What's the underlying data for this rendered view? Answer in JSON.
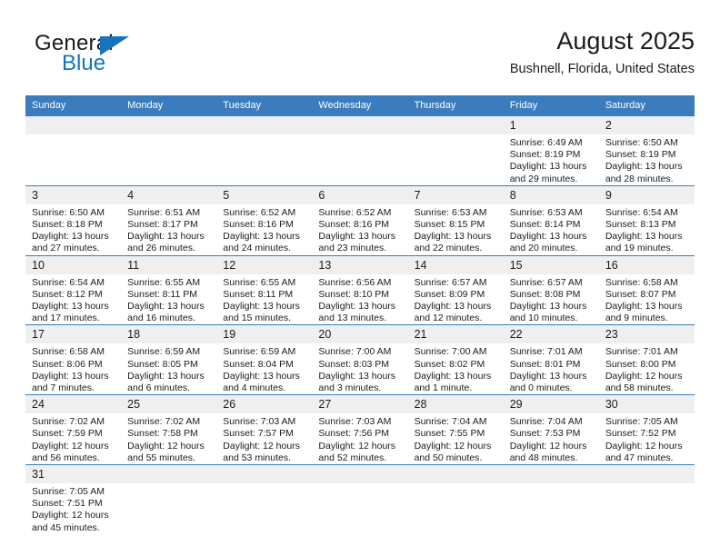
{
  "brand": {
    "word_general": "General",
    "word_blue": "Blue",
    "triangle_color": "#1574bb"
  },
  "header": {
    "title": "August 2025",
    "subtitle": "Bushnell, Florida, United States"
  },
  "colors": {
    "header_row": "#3b7cbe",
    "daynum_band": "#efefef",
    "accent": "#1574bb",
    "text": "#1b1b1b"
  },
  "labels": {
    "sunrise_prefix": "Sunrise:",
    "sunset_prefix": "Sunset:",
    "daylight_prefix": "Daylight:"
  },
  "weekdays": [
    "Sunday",
    "Monday",
    "Tuesday",
    "Wednesday",
    "Thursday",
    "Friday",
    "Saturday"
  ],
  "weeks": [
    [
      {
        "day": "",
        "empty": true
      },
      {
        "day": "",
        "empty": true
      },
      {
        "day": "",
        "empty": true
      },
      {
        "day": "",
        "empty": true
      },
      {
        "day": "",
        "empty": true
      },
      {
        "day": "1",
        "sunrise": "Sunrise: 6:49 AM",
        "sunset": "Sunset: 8:19 PM",
        "daylight_line1": "Daylight: 13 hours",
        "daylight_line2": "and 29 minutes."
      },
      {
        "day": "2",
        "sunrise": "Sunrise: 6:50 AM",
        "sunset": "Sunset: 8:19 PM",
        "daylight_line1": "Daylight: 13 hours",
        "daylight_line2": "and 28 minutes."
      }
    ],
    [
      {
        "day": "3",
        "sunrise": "Sunrise: 6:50 AM",
        "sunset": "Sunset: 8:18 PM",
        "daylight_line1": "Daylight: 13 hours",
        "daylight_line2": "and 27 minutes."
      },
      {
        "day": "4",
        "sunrise": "Sunrise: 6:51 AM",
        "sunset": "Sunset: 8:17 PM",
        "daylight_line1": "Daylight: 13 hours",
        "daylight_line2": "and 26 minutes."
      },
      {
        "day": "5",
        "sunrise": "Sunrise: 6:52 AM",
        "sunset": "Sunset: 8:16 PM",
        "daylight_line1": "Daylight: 13 hours",
        "daylight_line2": "and 24 minutes."
      },
      {
        "day": "6",
        "sunrise": "Sunrise: 6:52 AM",
        "sunset": "Sunset: 8:16 PM",
        "daylight_line1": "Daylight: 13 hours",
        "daylight_line2": "and 23 minutes."
      },
      {
        "day": "7",
        "sunrise": "Sunrise: 6:53 AM",
        "sunset": "Sunset: 8:15 PM",
        "daylight_line1": "Daylight: 13 hours",
        "daylight_line2": "and 22 minutes."
      },
      {
        "day": "8",
        "sunrise": "Sunrise: 6:53 AM",
        "sunset": "Sunset: 8:14 PM",
        "daylight_line1": "Daylight: 13 hours",
        "daylight_line2": "and 20 minutes."
      },
      {
        "day": "9",
        "sunrise": "Sunrise: 6:54 AM",
        "sunset": "Sunset: 8:13 PM",
        "daylight_line1": "Daylight: 13 hours",
        "daylight_line2": "and 19 minutes."
      }
    ],
    [
      {
        "day": "10",
        "sunrise": "Sunrise: 6:54 AM",
        "sunset": "Sunset: 8:12 PM",
        "daylight_line1": "Daylight: 13 hours",
        "daylight_line2": "and 17 minutes."
      },
      {
        "day": "11",
        "sunrise": "Sunrise: 6:55 AM",
        "sunset": "Sunset: 8:11 PM",
        "daylight_line1": "Daylight: 13 hours",
        "daylight_line2": "and 16 minutes."
      },
      {
        "day": "12",
        "sunrise": "Sunrise: 6:55 AM",
        "sunset": "Sunset: 8:11 PM",
        "daylight_line1": "Daylight: 13 hours",
        "daylight_line2": "and 15 minutes."
      },
      {
        "day": "13",
        "sunrise": "Sunrise: 6:56 AM",
        "sunset": "Sunset: 8:10 PM",
        "daylight_line1": "Daylight: 13 hours",
        "daylight_line2": "and 13 minutes."
      },
      {
        "day": "14",
        "sunrise": "Sunrise: 6:57 AM",
        "sunset": "Sunset: 8:09 PM",
        "daylight_line1": "Daylight: 13 hours",
        "daylight_line2": "and 12 minutes."
      },
      {
        "day": "15",
        "sunrise": "Sunrise: 6:57 AM",
        "sunset": "Sunset: 8:08 PM",
        "daylight_line1": "Daylight: 13 hours",
        "daylight_line2": "and 10 minutes."
      },
      {
        "day": "16",
        "sunrise": "Sunrise: 6:58 AM",
        "sunset": "Sunset: 8:07 PM",
        "daylight_line1": "Daylight: 13 hours",
        "daylight_line2": "and 9 minutes."
      }
    ],
    [
      {
        "day": "17",
        "sunrise": "Sunrise: 6:58 AM",
        "sunset": "Sunset: 8:06 PM",
        "daylight_line1": "Daylight: 13 hours",
        "daylight_line2": "and 7 minutes."
      },
      {
        "day": "18",
        "sunrise": "Sunrise: 6:59 AM",
        "sunset": "Sunset: 8:05 PM",
        "daylight_line1": "Daylight: 13 hours",
        "daylight_line2": "and 6 minutes."
      },
      {
        "day": "19",
        "sunrise": "Sunrise: 6:59 AM",
        "sunset": "Sunset: 8:04 PM",
        "daylight_line1": "Daylight: 13 hours",
        "daylight_line2": "and 4 minutes."
      },
      {
        "day": "20",
        "sunrise": "Sunrise: 7:00 AM",
        "sunset": "Sunset: 8:03 PM",
        "daylight_line1": "Daylight: 13 hours",
        "daylight_line2": "and 3 minutes."
      },
      {
        "day": "21",
        "sunrise": "Sunrise: 7:00 AM",
        "sunset": "Sunset: 8:02 PM",
        "daylight_line1": "Daylight: 13 hours",
        "daylight_line2": "and 1 minute."
      },
      {
        "day": "22",
        "sunrise": "Sunrise: 7:01 AM",
        "sunset": "Sunset: 8:01 PM",
        "daylight_line1": "Daylight: 13 hours",
        "daylight_line2": "and 0 minutes."
      },
      {
        "day": "23",
        "sunrise": "Sunrise: 7:01 AM",
        "sunset": "Sunset: 8:00 PM",
        "daylight_line1": "Daylight: 12 hours",
        "daylight_line2": "and 58 minutes."
      }
    ],
    [
      {
        "day": "24",
        "sunrise": "Sunrise: 7:02 AM",
        "sunset": "Sunset: 7:59 PM",
        "daylight_line1": "Daylight: 12 hours",
        "daylight_line2": "and 56 minutes."
      },
      {
        "day": "25",
        "sunrise": "Sunrise: 7:02 AM",
        "sunset": "Sunset: 7:58 PM",
        "daylight_line1": "Daylight: 12 hours",
        "daylight_line2": "and 55 minutes."
      },
      {
        "day": "26",
        "sunrise": "Sunrise: 7:03 AM",
        "sunset": "Sunset: 7:57 PM",
        "daylight_line1": "Daylight: 12 hours",
        "daylight_line2": "and 53 minutes."
      },
      {
        "day": "27",
        "sunrise": "Sunrise: 7:03 AM",
        "sunset": "Sunset: 7:56 PM",
        "daylight_line1": "Daylight: 12 hours",
        "daylight_line2": "and 52 minutes."
      },
      {
        "day": "28",
        "sunrise": "Sunrise: 7:04 AM",
        "sunset": "Sunset: 7:55 PM",
        "daylight_line1": "Daylight: 12 hours",
        "daylight_line2": "and 50 minutes."
      },
      {
        "day": "29",
        "sunrise": "Sunrise: 7:04 AM",
        "sunset": "Sunset: 7:53 PM",
        "daylight_line1": "Daylight: 12 hours",
        "daylight_line2": "and 48 minutes."
      },
      {
        "day": "30",
        "sunrise": "Sunrise: 7:05 AM",
        "sunset": "Sunset: 7:52 PM",
        "daylight_line1": "Daylight: 12 hours",
        "daylight_line2": "and 47 minutes."
      }
    ],
    [
      {
        "day": "31",
        "sunrise": "Sunrise: 7:05 AM",
        "sunset": "Sunset: 7:51 PM",
        "daylight_line1": "Daylight: 12 hours",
        "daylight_line2": "and 45 minutes."
      },
      {
        "day": "",
        "empty": true
      },
      {
        "day": "",
        "empty": true
      },
      {
        "day": "",
        "empty": true
      },
      {
        "day": "",
        "empty": true
      },
      {
        "day": "",
        "empty": true
      },
      {
        "day": "",
        "empty": true
      }
    ]
  ]
}
